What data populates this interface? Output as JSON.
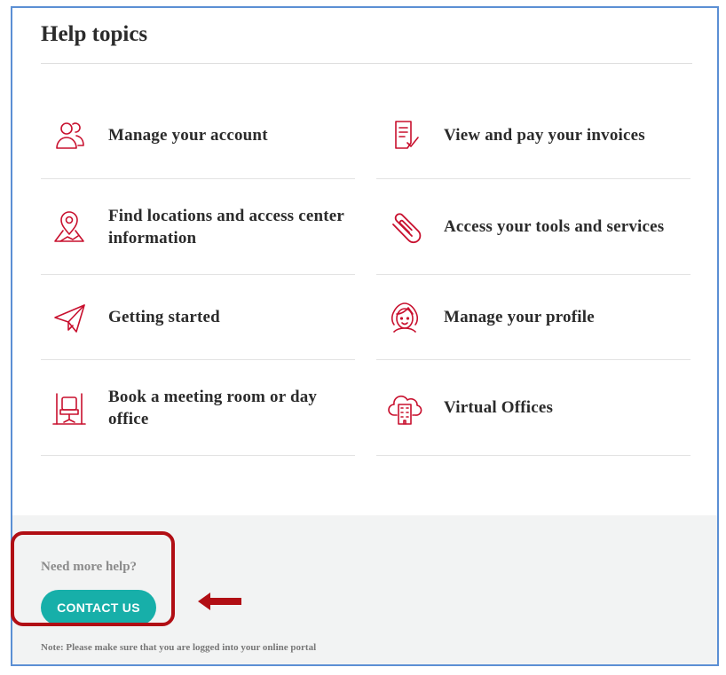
{
  "section_title": "Help topics",
  "topics": [
    {
      "label": "Manage your account",
      "icon": "users-icon"
    },
    {
      "label": "View and pay your invoices",
      "icon": "invoice-icon"
    },
    {
      "label": "Find locations and access center information",
      "icon": "map-pin-icon"
    },
    {
      "label": "Access your tools and services",
      "icon": "paperclip-icon"
    },
    {
      "label": "Getting started",
      "icon": "paper-plane-icon"
    },
    {
      "label": "Manage your profile",
      "icon": "profile-face-icon"
    },
    {
      "label": "Book a meeting room or day office",
      "icon": "meeting-room-icon"
    },
    {
      "label": "Virtual Offices",
      "icon": "cloud-building-icon"
    }
  ],
  "footer": {
    "need_help": "Need more help?",
    "contact_label": "CONTACT US",
    "note": "Note: Please make sure that you are logged into your online portal"
  },
  "colors": {
    "accent": "#c8102e",
    "button": "#17afa9",
    "annotation": "#b10e14",
    "frame": "#5b8fd4"
  }
}
